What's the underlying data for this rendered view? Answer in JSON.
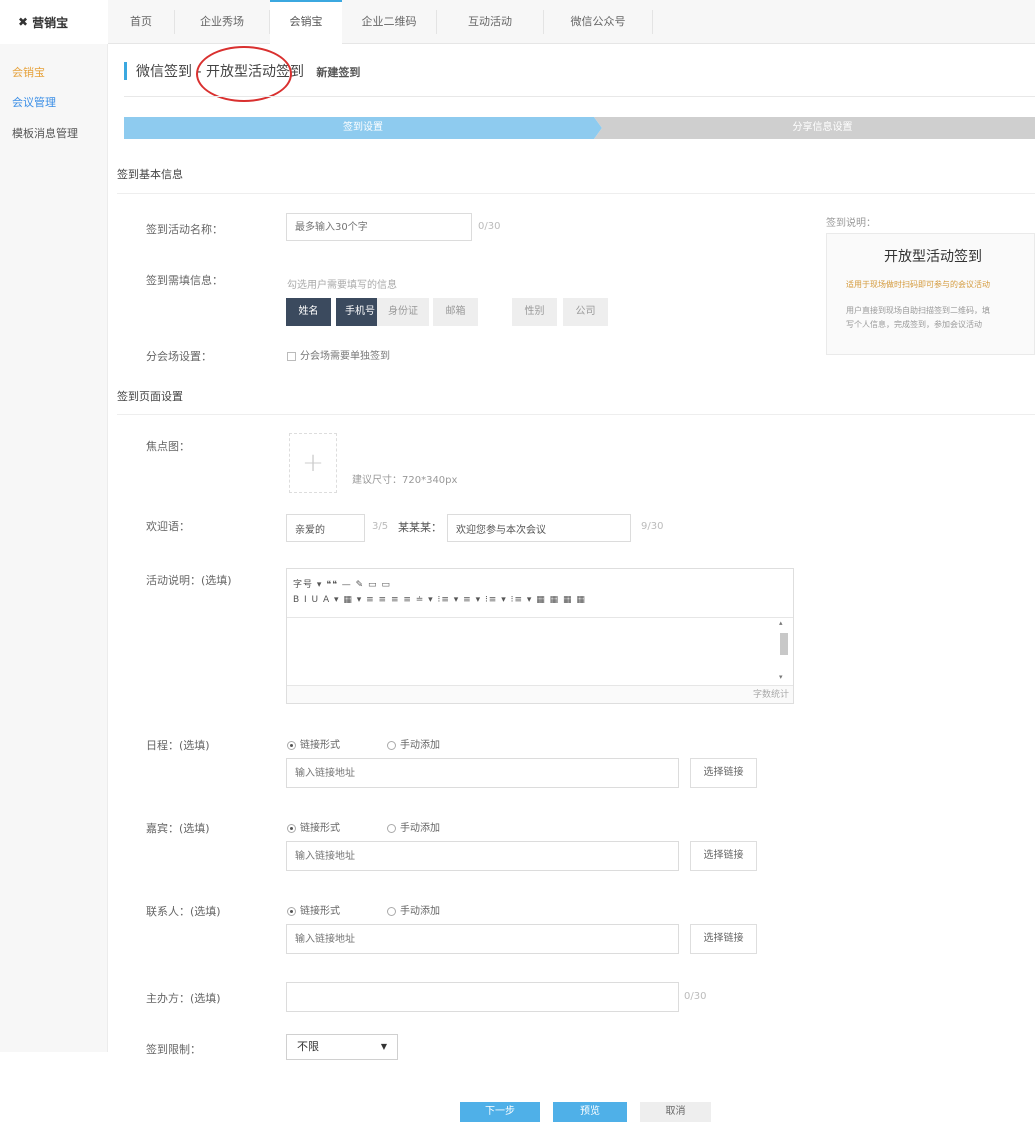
{
  "brand": {
    "logo": "✖",
    "name": "营销宝"
  },
  "topnav": {
    "tabs": [
      {
        "label": "首页"
      },
      {
        "label": "企业秀场"
      },
      {
        "label": "会销宝"
      },
      {
        "label": "企业二维码"
      },
      {
        "label": "互动活动"
      },
      {
        "label": "微信公众号"
      }
    ],
    "active_index": 2
  },
  "sidebar": {
    "items": [
      {
        "label": "会销宝",
        "color": "#e6a23c"
      },
      {
        "label": "会议管理",
        "color": "#3a8ee6"
      },
      {
        "label": "模板消息管理",
        "color": "#555555"
      }
    ]
  },
  "breadcrumb": {
    "part1": "微信签到",
    "sep": " - ",
    "part2": "开放型活动签到",
    "sub": "新建签到"
  },
  "steps": [
    "签到设置",
    "分享信息设置"
  ],
  "basic_section": {
    "title": "签到基本信息",
    "name_label": "签到活动名称：",
    "name_placeholder": "最多输入30个字",
    "name_counter": "0/30",
    "required_label": "签到需填信息：",
    "required_hint": "勾选用户需要填写的信息",
    "tags": [
      {
        "label": "姓名",
        "on": true
      },
      {
        "label": "手机号",
        "on": true
      },
      {
        "label": "身份证",
        "on": false
      },
      {
        "label": "邮箱",
        "on": false
      },
      {
        "label": "性别",
        "on": false
      },
      {
        "label": "公司",
        "on": false
      }
    ],
    "branch_label": "分会场设置：",
    "branch_option": "分会场需要单独签到"
  },
  "info_box": {
    "caption": "签到说明：",
    "title": "开放型活动签到",
    "highlight": "适用于现场做时扫码即可参与的会议活动",
    "desc_line1": "用户直接到现场自助扫描签到二维码，填",
    "desc_line2": "写个人信息，完成签到，参加会议活动"
  },
  "page_section": {
    "title": "签到页面设置",
    "focus_label": "焦点图：",
    "focus_hint": "建议尺寸：720*340px",
    "welcome_label": "欢迎语：",
    "welcome_prefix": "亲爱的",
    "welcome_prefix_counter": "3/5",
    "welcome_name": "某某某：",
    "welcome_text": "欢迎您参与本次会议",
    "welcome_text_counter": "9/30",
    "desc_label": "活动说明：(选填)",
    "editor_row1": "字号  ▾ ❝❝ — ✎ ▭ ▭",
    "editor_row2": "B  I  U  A ▾ ▦ ▾ ≡ ≡ ≡ ≡ ≐ ▾ ⁝≡ ▾ ≡ ▾ ⁝≡ ▾ ⁝≡ ▾ ▦ ▦ ▦ ▦",
    "editor_count": "字数统计",
    "schedule_label": "日程：(选填)",
    "guest_label": "嘉宾：(选填)",
    "contact_label": "联系人：(选填)",
    "radio_link": "链接形式",
    "radio_manual": "手动添加",
    "link_placeholder": "输入链接地址",
    "choose_link": "选择链接",
    "host_label": "主办方：(选填)",
    "host_counter": "0/30",
    "limit_label": "签到限制：",
    "limit_value": "不限"
  },
  "actions": {
    "next": "下一步",
    "preview": "预览",
    "cancel": "取消"
  }
}
